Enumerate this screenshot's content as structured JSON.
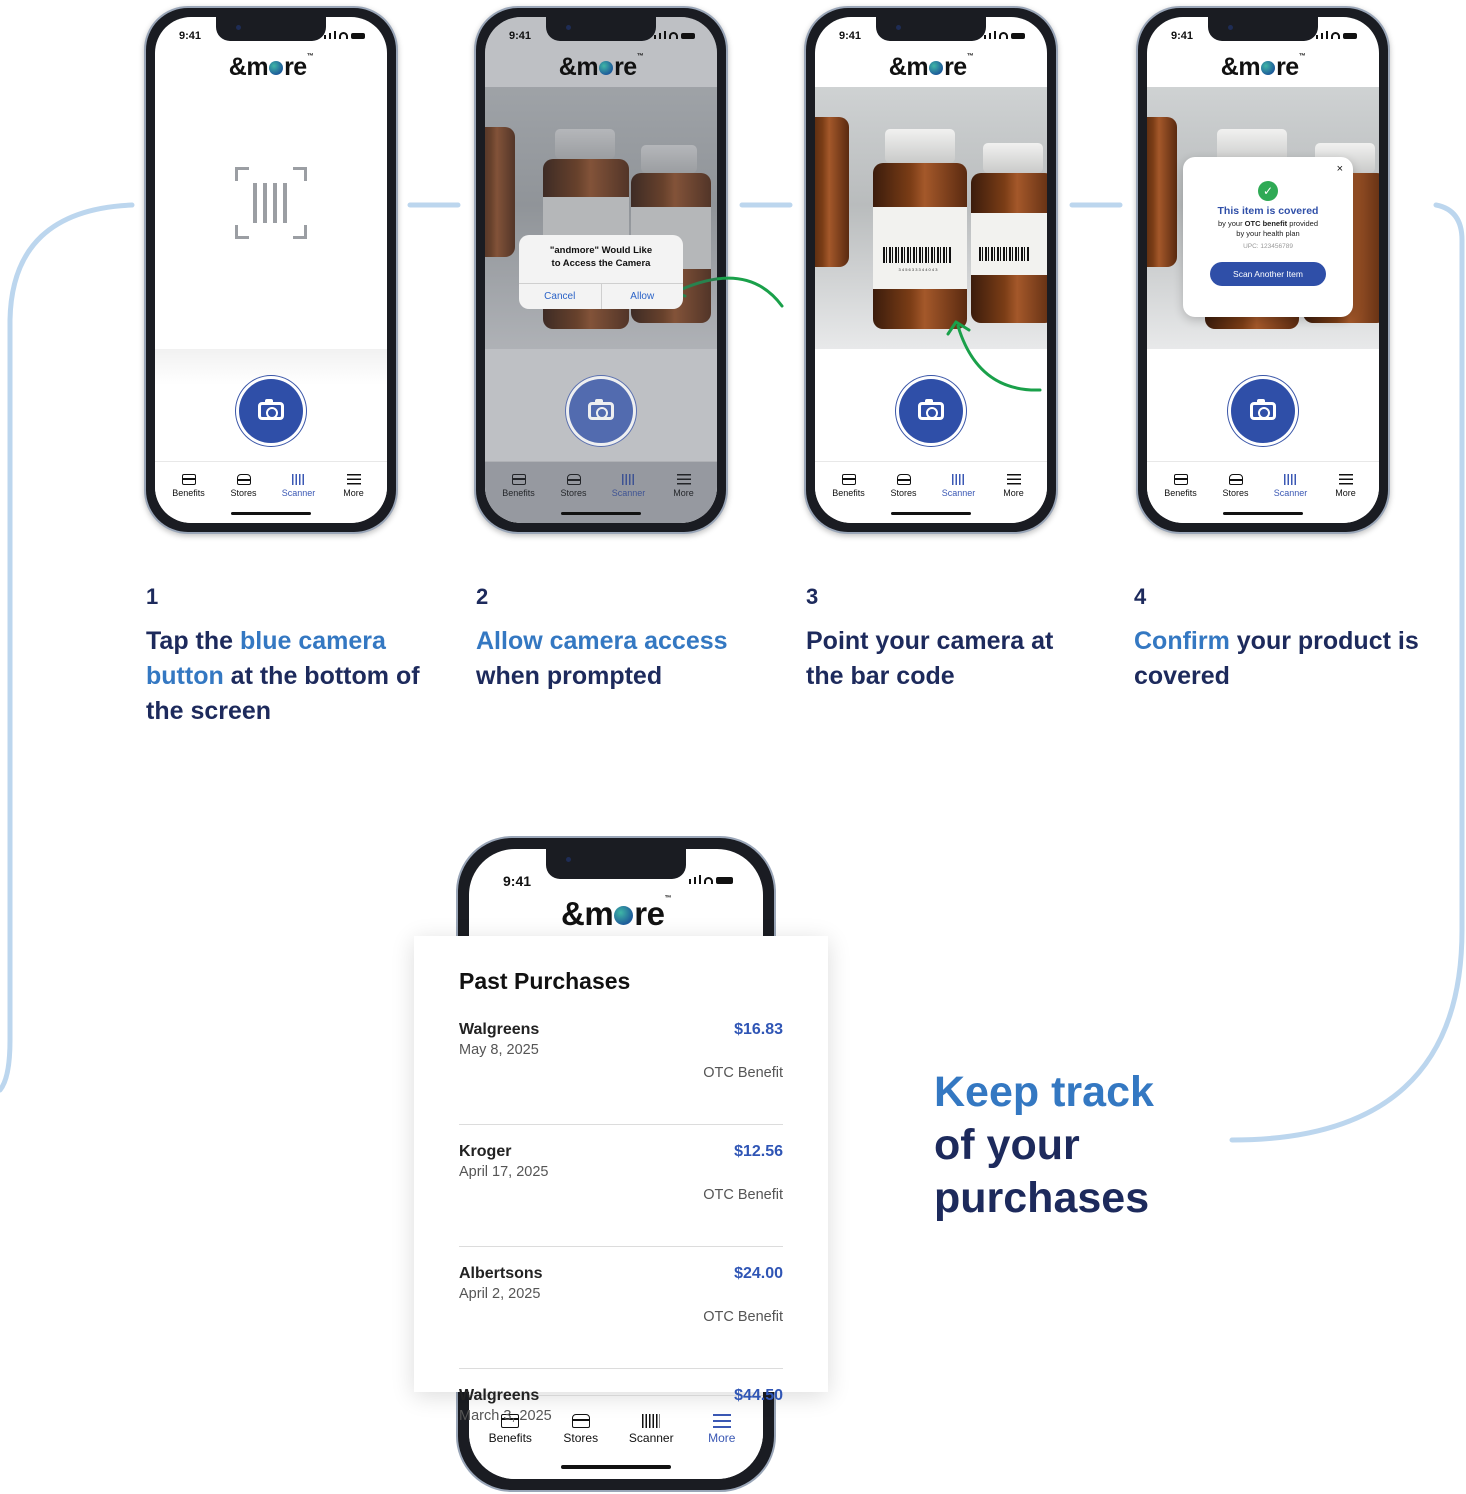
{
  "status": {
    "time": "9:41"
  },
  "brand": {
    "logo_prefix": "&m",
    "logo_suffix": "re",
    "trademark": "™"
  },
  "tabs": [
    "Benefits",
    "Stores",
    "Scanner",
    "More"
  ],
  "permission_dialog": {
    "title_line1": "\"andmore\" Would Like",
    "title_line2": "to Access the Camera",
    "cancel": "Cancel",
    "allow": "Allow"
  },
  "barcode_number": "3 4 5 6 3 3 3 4 4 0 4 3",
  "coverage_popup": {
    "close": "×",
    "title": "This item is covered",
    "line1_pre": "by your ",
    "line1_bold": "OTC benefit",
    "line1_post": " provided",
    "line2": "by your health plan",
    "upc": "UPC: 123456789",
    "button": "Scan Another Item"
  },
  "steps": [
    {
      "num": "1",
      "pre": "Tap the ",
      "hl": "blue camera button",
      "post": " at the bottom of the screen"
    },
    {
      "num": "2",
      "pre": "",
      "hl": "Allow camera access",
      "post": " when prompted"
    },
    {
      "num": "3",
      "pre": "Point your camera at the bar code",
      "hl": "",
      "post": ""
    },
    {
      "num": "4",
      "pre": "",
      "hl": "Confirm",
      "post": " your product is covered"
    }
  ],
  "past_purchases": {
    "title": "Past Purchases",
    "items": [
      {
        "store": "Walgreens",
        "date": "May 8, 2025",
        "amount": "$16.83",
        "benefit": "OTC Benefit"
      },
      {
        "store": "Kroger",
        "date": "April 17, 2025",
        "amount": "$12.56",
        "benefit": "OTC Benefit"
      },
      {
        "store": "Albertsons",
        "date": "April 2, 2025",
        "amount": "$24.00",
        "benefit": "OTC Benefit"
      },
      {
        "store": "Walgreens",
        "date": "March 3, 2025",
        "amount": "$44.50",
        "benefit": ""
      }
    ]
  },
  "keep_track": {
    "line1": "Keep track",
    "line2": "of your",
    "line3": "purchases"
  },
  "colors": {
    "navy": "#1d2a5c",
    "accent": "#3478c2",
    "button": "#2f4fa8",
    "connector": "#bcd6ee",
    "arrow": "#1aa04a",
    "check": "#2faa55"
  },
  "icons": [
    "camera-icon",
    "barcode-icon",
    "card-icon",
    "store-icon",
    "menu-icon",
    "check-icon",
    "close-icon",
    "curved-arrow-icon",
    "signal-icon",
    "wifi-icon",
    "battery-icon"
  ]
}
